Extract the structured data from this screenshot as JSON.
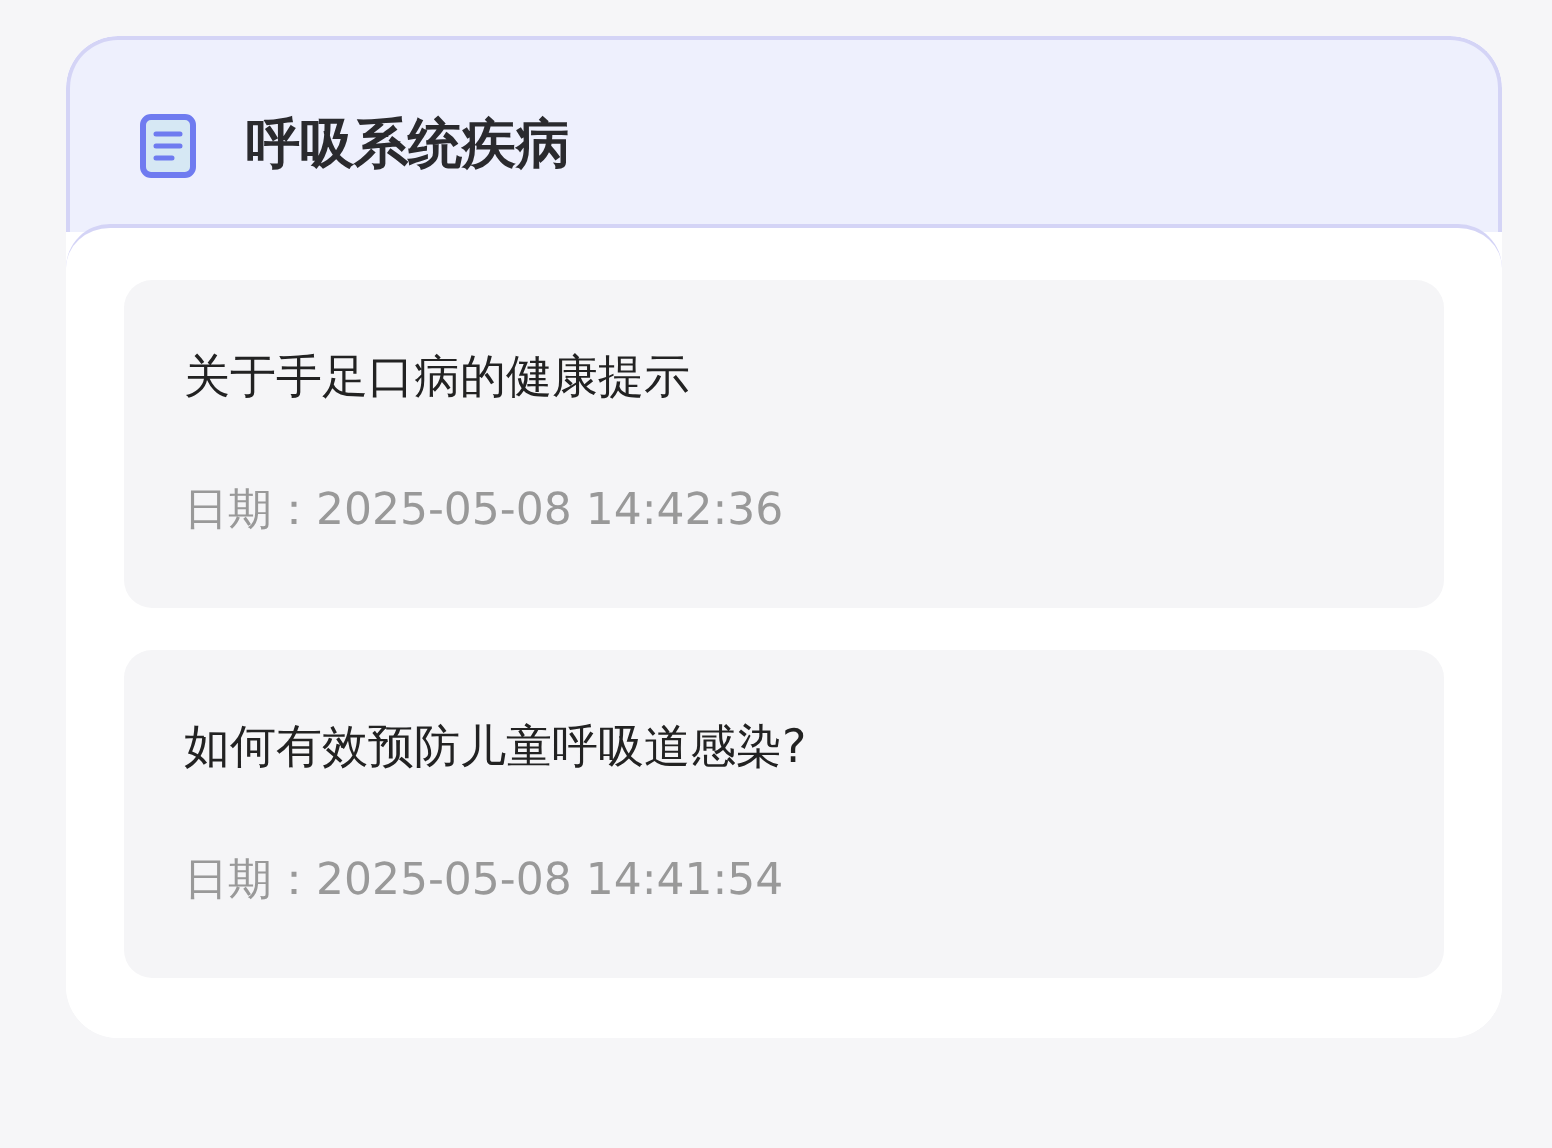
{
  "panel": {
    "title": "呼吸系统疾病"
  },
  "articles": [
    {
      "title": "关于手足口病的健康提示",
      "date": "日期：2025-05-08 14:42:36"
    },
    {
      "title": "如何有效预防儿童呼吸道感染?",
      "date": "日期：2025-05-08 14:41:54"
    }
  ]
}
